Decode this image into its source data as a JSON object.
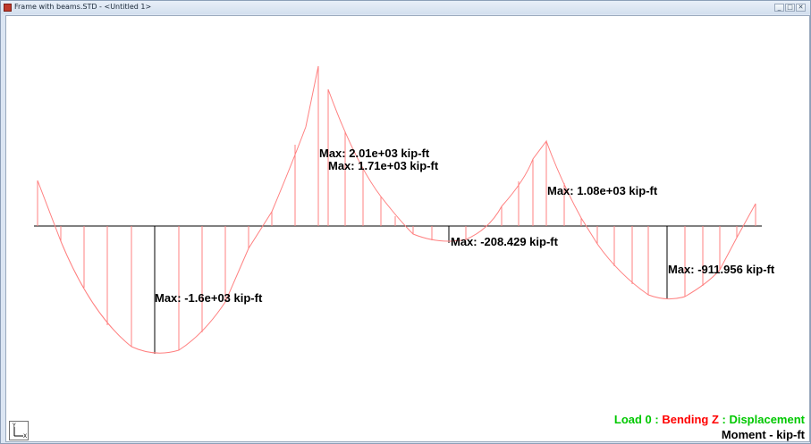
{
  "window": {
    "title": "Frame with beams.STD - <Untitled 1>"
  },
  "window_buttons": [
    "_",
    "□",
    "✕"
  ],
  "axis_widget": {
    "y_label": "Y",
    "x_label": "X"
  },
  "diagram": {
    "labels": [
      "Max: 2.01e+03 kip-ft",
      "Max: 1.71e+03 kip-ft",
      "Max: -1.6e+03 kip-ft",
      "Max: -208.429 kip-ft",
      "Max: 1.08e+03 kip-ft",
      "Max: -911.956 kip-ft"
    ],
    "colors": {
      "curve": "#ff8080",
      "baseline": "#000000"
    }
  },
  "legend": {
    "load": "Load 0",
    "sep1": " : ",
    "bending": "Bending Z",
    "sep2": " : ",
    "displacement": "Displacement",
    "unit_line": "Moment - kip-ft"
  }
}
